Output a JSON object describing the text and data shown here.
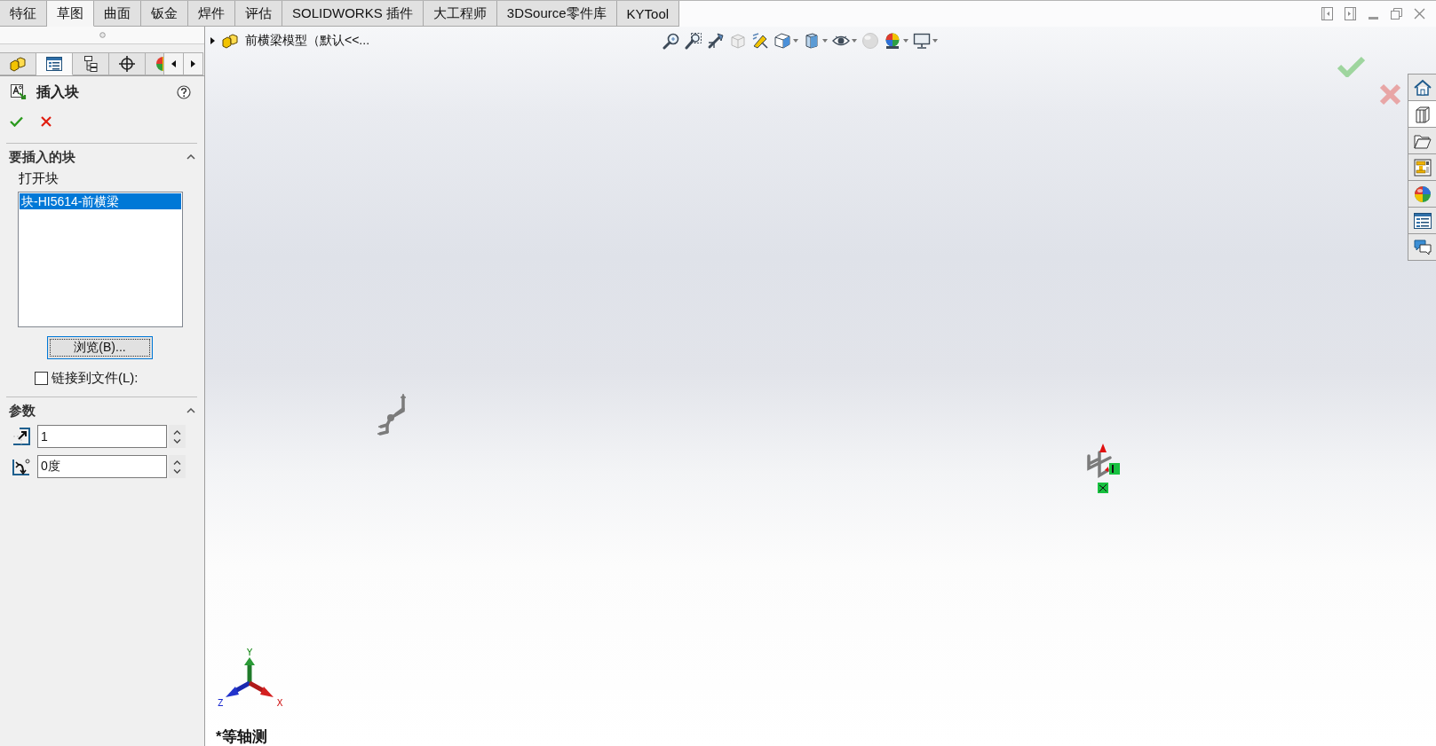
{
  "command_tabs": [
    {
      "label": "特征",
      "selected": false
    },
    {
      "label": "草图",
      "selected": true
    },
    {
      "label": "曲面",
      "selected": false
    },
    {
      "label": "钣金",
      "selected": false
    },
    {
      "label": "焊件",
      "selected": false
    },
    {
      "label": "评估",
      "selected": false
    },
    {
      "label": "SOLIDWORKS 插件",
      "selected": false
    },
    {
      "label": "大工程师",
      "selected": false
    },
    {
      "label": "3DSource零件库",
      "selected": false
    },
    {
      "label": "KYTool",
      "selected": false
    }
  ],
  "property_manager": {
    "panel_tabs": [
      {
        "kind": "features",
        "selected": false
      },
      {
        "kind": "properties",
        "selected": true
      },
      {
        "kind": "configurations",
        "selected": false
      },
      {
        "kind": "dimxpert",
        "selected": false
      },
      {
        "kind": "display",
        "selected": false
      }
    ],
    "title": "插入块",
    "sections": [
      {
        "kind": "blocks",
        "title": "要插入的块",
        "expanded": true,
        "label": "打开块",
        "list_items": [
          {
            "label": "块-HI5614-前横梁",
            "selected": true
          }
        ],
        "browse_button": "浏览(B)...",
        "link_checkbox": {
          "label": "链接到文件(L):",
          "checked": false
        }
      },
      {
        "kind": "parameters",
        "title": "参数",
        "expanded": true,
        "fields": [
          {
            "kind": "scale",
            "value": "1"
          },
          {
            "kind": "angle",
            "value": "0度"
          }
        ]
      }
    ]
  },
  "viewport": {
    "breadcrumb": "前横梁模型（默认<<...",
    "heads_up_toolbar": [
      {
        "kind": "zoom-fit",
        "disabled": false,
        "dropdown": false
      },
      {
        "kind": "zoom-area",
        "disabled": false,
        "dropdown": false
      },
      {
        "kind": "previous-view",
        "disabled": false,
        "dropdown": false
      },
      {
        "kind": "section-view",
        "disabled": true,
        "dropdown": false
      },
      {
        "kind": "annotation",
        "disabled": false,
        "dropdown": false
      },
      {
        "kind": "orientation",
        "disabled": false,
        "dropdown": true
      },
      {
        "kind": "display-style",
        "disabled": false,
        "dropdown": true
      },
      {
        "kind": "hide-show",
        "disabled": false,
        "dropdown": true
      },
      {
        "kind": "appearance",
        "disabled": true,
        "dropdown": false
      },
      {
        "kind": "scene",
        "disabled": false,
        "dropdown": true
      },
      {
        "kind": "view-settings",
        "disabled": false,
        "dropdown": true
      }
    ],
    "task_pane_tabs": [
      {
        "kind": "home",
        "selected": false
      },
      {
        "kind": "library",
        "selected": true
      },
      {
        "kind": "explorer",
        "selected": false
      },
      {
        "kind": "view-palette",
        "selected": false
      },
      {
        "kind": "appearances",
        "selected": false
      },
      {
        "kind": "properties",
        "selected": false
      },
      {
        "kind": "forum",
        "selected": false
      }
    ],
    "triad": {
      "x": "X",
      "y": "Y",
      "z": "Z"
    },
    "view_name": "*等轴测"
  }
}
